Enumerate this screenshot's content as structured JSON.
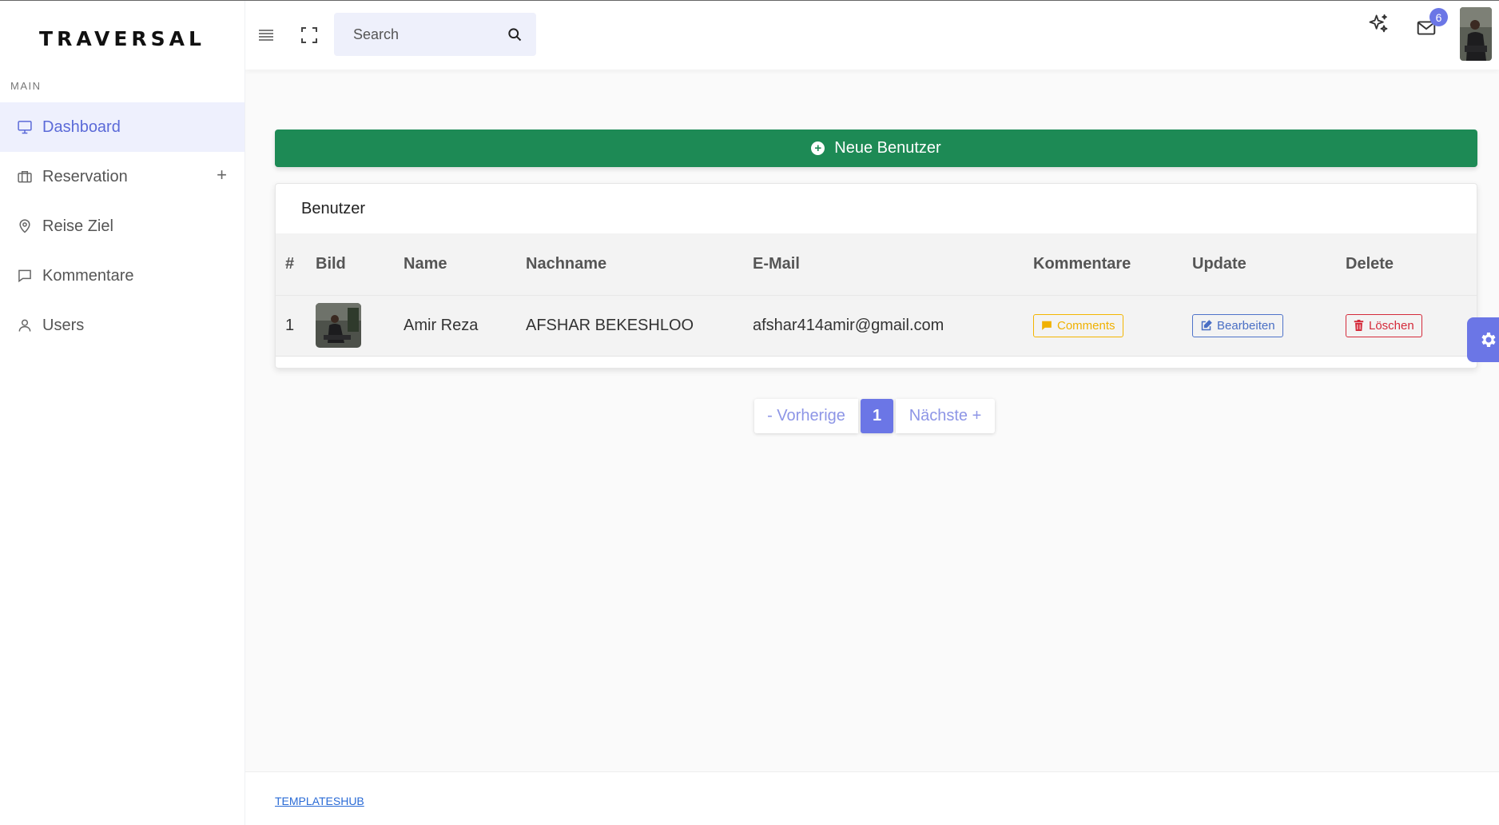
{
  "brand": "TRAVERSAL",
  "sidebar": {
    "section_label": "MAIN",
    "items": [
      {
        "label": "Dashboard",
        "icon": "monitor-icon",
        "active": true
      },
      {
        "label": "Reservation",
        "icon": "briefcase-icon",
        "expandable": true,
        "expand_symbol": "+"
      },
      {
        "label": "Reise Ziel",
        "icon": "map-pin-icon"
      },
      {
        "label": "Kommentare",
        "icon": "message-icon"
      },
      {
        "label": "Users",
        "icon": "user-icon"
      }
    ]
  },
  "header": {
    "search": {
      "placeholder": "Search",
      "value": ""
    },
    "mail_badge_count": "6",
    "icons": [
      "menu-icon",
      "fullscreen-icon",
      "search-icon",
      "sparkle-icon",
      "mail-icon",
      "avatar"
    ]
  },
  "main": {
    "new_button_label": "Neue Benutzer",
    "card_title": "Benutzer",
    "table": {
      "headers": [
        "#",
        "Bild",
        "Name",
        "Nachname",
        "E-Mail",
        "Kommentare",
        "Update",
        "Delete"
      ],
      "rows": [
        {
          "index": "1",
          "name": "Amir Reza",
          "lastname": "AFSHAR BEKESHLOO",
          "email": "afshar414amir@gmail.com",
          "comments_label": "Comments",
          "update_label": "Bearbeiten",
          "delete_label": "Löschen"
        }
      ]
    },
    "pagination": {
      "prev": "- Vorherige",
      "current": "1",
      "next": "Nächste +"
    }
  },
  "footer": {
    "link": "TEMPLATESHUB"
  },
  "colors": {
    "primary": "#6b76e6",
    "success": "#1d8a55",
    "warning": "#f0b100",
    "danger": "#d42a3a",
    "info": "#4a6fc4"
  }
}
